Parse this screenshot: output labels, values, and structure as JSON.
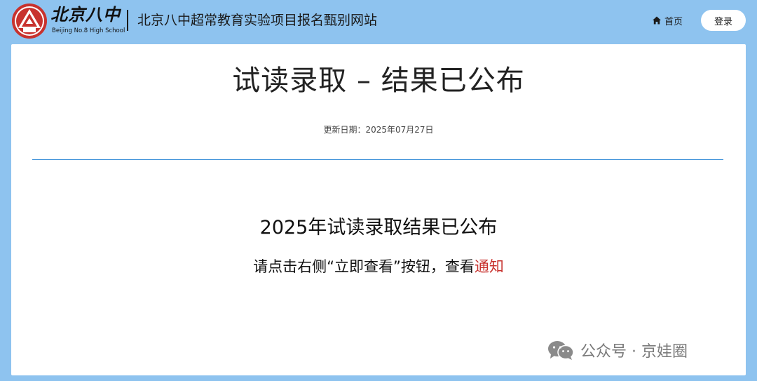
{
  "header": {
    "brand_cn": "北京八中",
    "brand_en": "Beijing No.8 High School",
    "site_title": "北京八中超常教育实验项目报名甄别网站",
    "nav_home_label": "首页",
    "login_label": "登录"
  },
  "icons": {
    "logo": "school-emblem",
    "home": "home-icon",
    "wechat": "wechat-icon"
  },
  "colors": {
    "page_background": "#8ec3ef",
    "divider": "#3a8fd8",
    "link_red": "#c8322e"
  },
  "main": {
    "page_title": "试读录取 – 结果已公布",
    "update_date": "更新日期：2025年07月27日",
    "result_heading": "2025年试读录取结果已公布",
    "instruction_text": "请点击右侧“立即查看”按钮，查看",
    "notice_link": "通知"
  },
  "watermark": {
    "text": "公众号 · 京娃圈"
  }
}
